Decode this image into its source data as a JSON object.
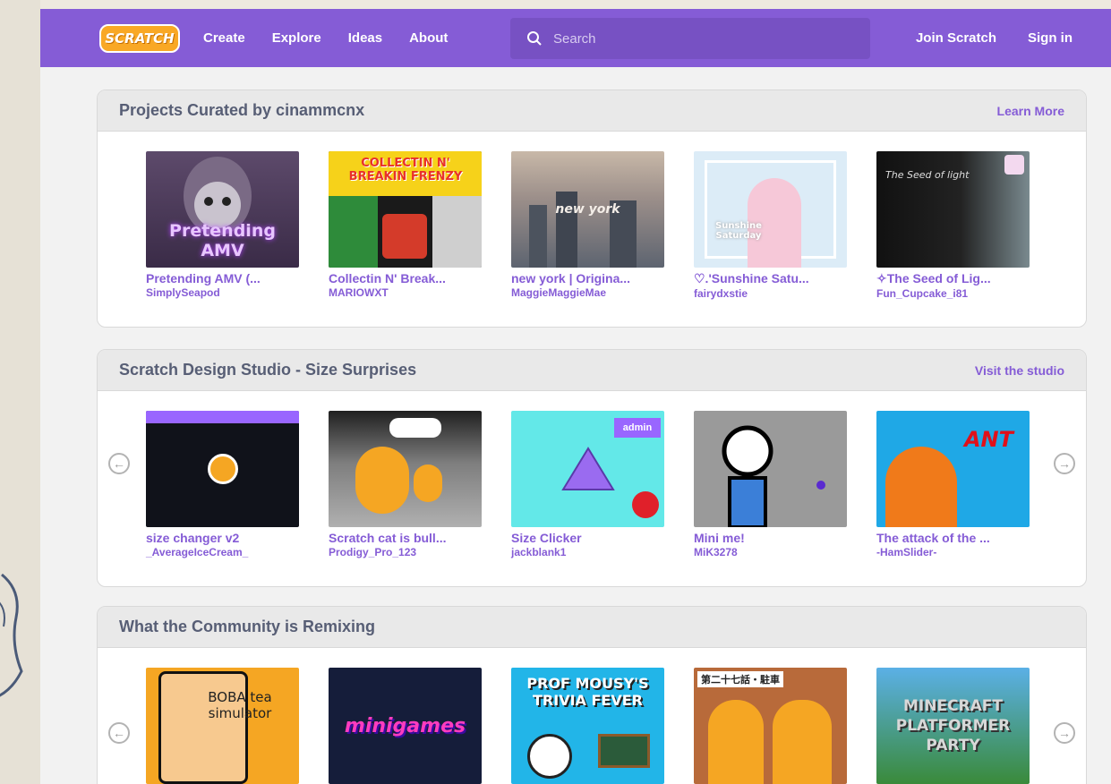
{
  "nav": {
    "logo": "SCRATCH",
    "links": [
      "Create",
      "Explore",
      "Ideas",
      "About"
    ],
    "search_placeholder": "Search",
    "join": "Join Scratch",
    "signin": "Sign in"
  },
  "sections": [
    {
      "title": "Projects Curated by cinammcnx",
      "link": "Learn More",
      "cards": [
        {
          "title": "Pretending AMV (...",
          "author": "SimplySeapod",
          "thumb_text": "Pretending AMV"
        },
        {
          "title": "Collectin N' Break...",
          "author": "MARIOWXT",
          "thumb_text": "COLLECTIN N' BREAKIN FRENZY"
        },
        {
          "title": "new york | Origina...",
          "author": "MaggieMaggieMae",
          "thumb_text": "new york"
        },
        {
          "title": "♡.'Sunshine Satu...",
          "author": "fairydxstie",
          "thumb_text": "Sunshine Saturday"
        },
        {
          "title": "✧The Seed of Lig...",
          "author": "Fun_Cupcake_i81",
          "thumb_text": "The Seed of light"
        }
      ]
    },
    {
      "title": "Scratch Design Studio - Size Surprises",
      "link": "Visit the studio",
      "cards": [
        {
          "title": "size changer v2",
          "author": "_AverageIceCream_",
          "thumb_text": ""
        },
        {
          "title": "Scratch cat is bull...",
          "author": "Prodigy_Pro_123",
          "thumb_text": ""
        },
        {
          "title": "Size Clicker",
          "author": "jackblank1",
          "thumb_text": "admin"
        },
        {
          "title": "Mini me!",
          "author": "MiK3278",
          "thumb_text": ""
        },
        {
          "title": "The attack of the ...",
          "author": "-HamSlider-",
          "thumb_text": "ANT"
        }
      ]
    },
    {
      "title": "What the Community is Remixing",
      "link": "",
      "cards": [
        {
          "title": "",
          "author": "",
          "thumb_text": "BOBA tea simulator"
        },
        {
          "title": "",
          "author": "",
          "thumb_text": "minigames"
        },
        {
          "title": "",
          "author": "",
          "thumb_text": "PROF MOUSY'S TRIVIA FEVER"
        },
        {
          "title": "",
          "author": "",
          "thumb_text": "第二十七話・駐車"
        },
        {
          "title": "",
          "author": "",
          "thumb_text": "MINECRAFT PLATFORMER PARTY"
        }
      ]
    }
  ],
  "colors": {
    "brand": "#855cd6",
    "nav_bg": "#855cd6",
    "search_bg": "#7751c3",
    "text_muted": "#575e75"
  }
}
